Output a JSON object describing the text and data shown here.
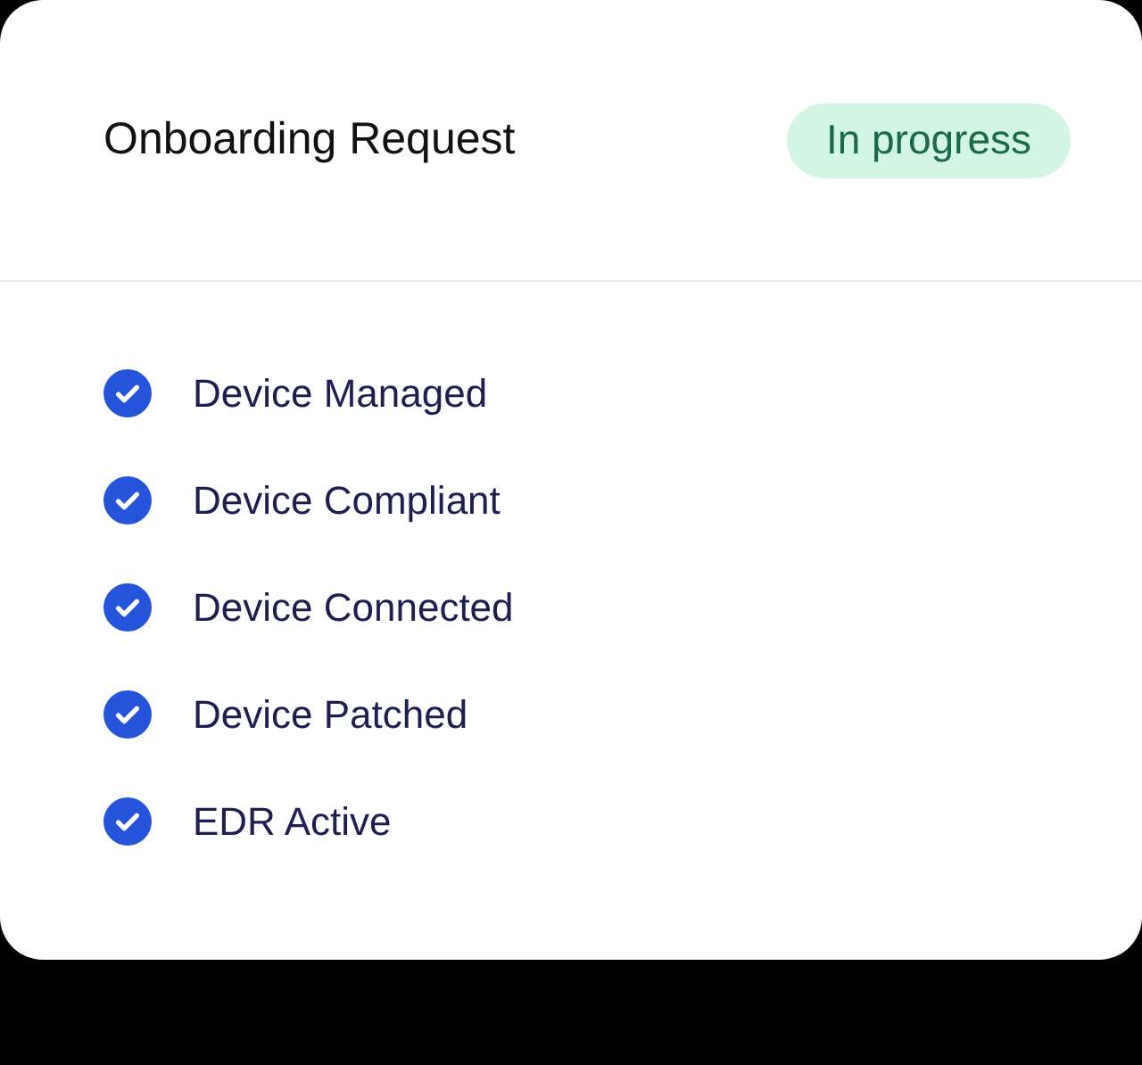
{
  "card": {
    "title": "Onboarding Request",
    "status": "In progress"
  },
  "checks": [
    {
      "label": "Device Managed",
      "checked": true
    },
    {
      "label": "Device Compliant",
      "checked": true
    },
    {
      "label": "Device Connected",
      "checked": true
    },
    {
      "label": "Device Patched",
      "checked": true
    },
    {
      "label": "EDR Active",
      "checked": true
    }
  ]
}
